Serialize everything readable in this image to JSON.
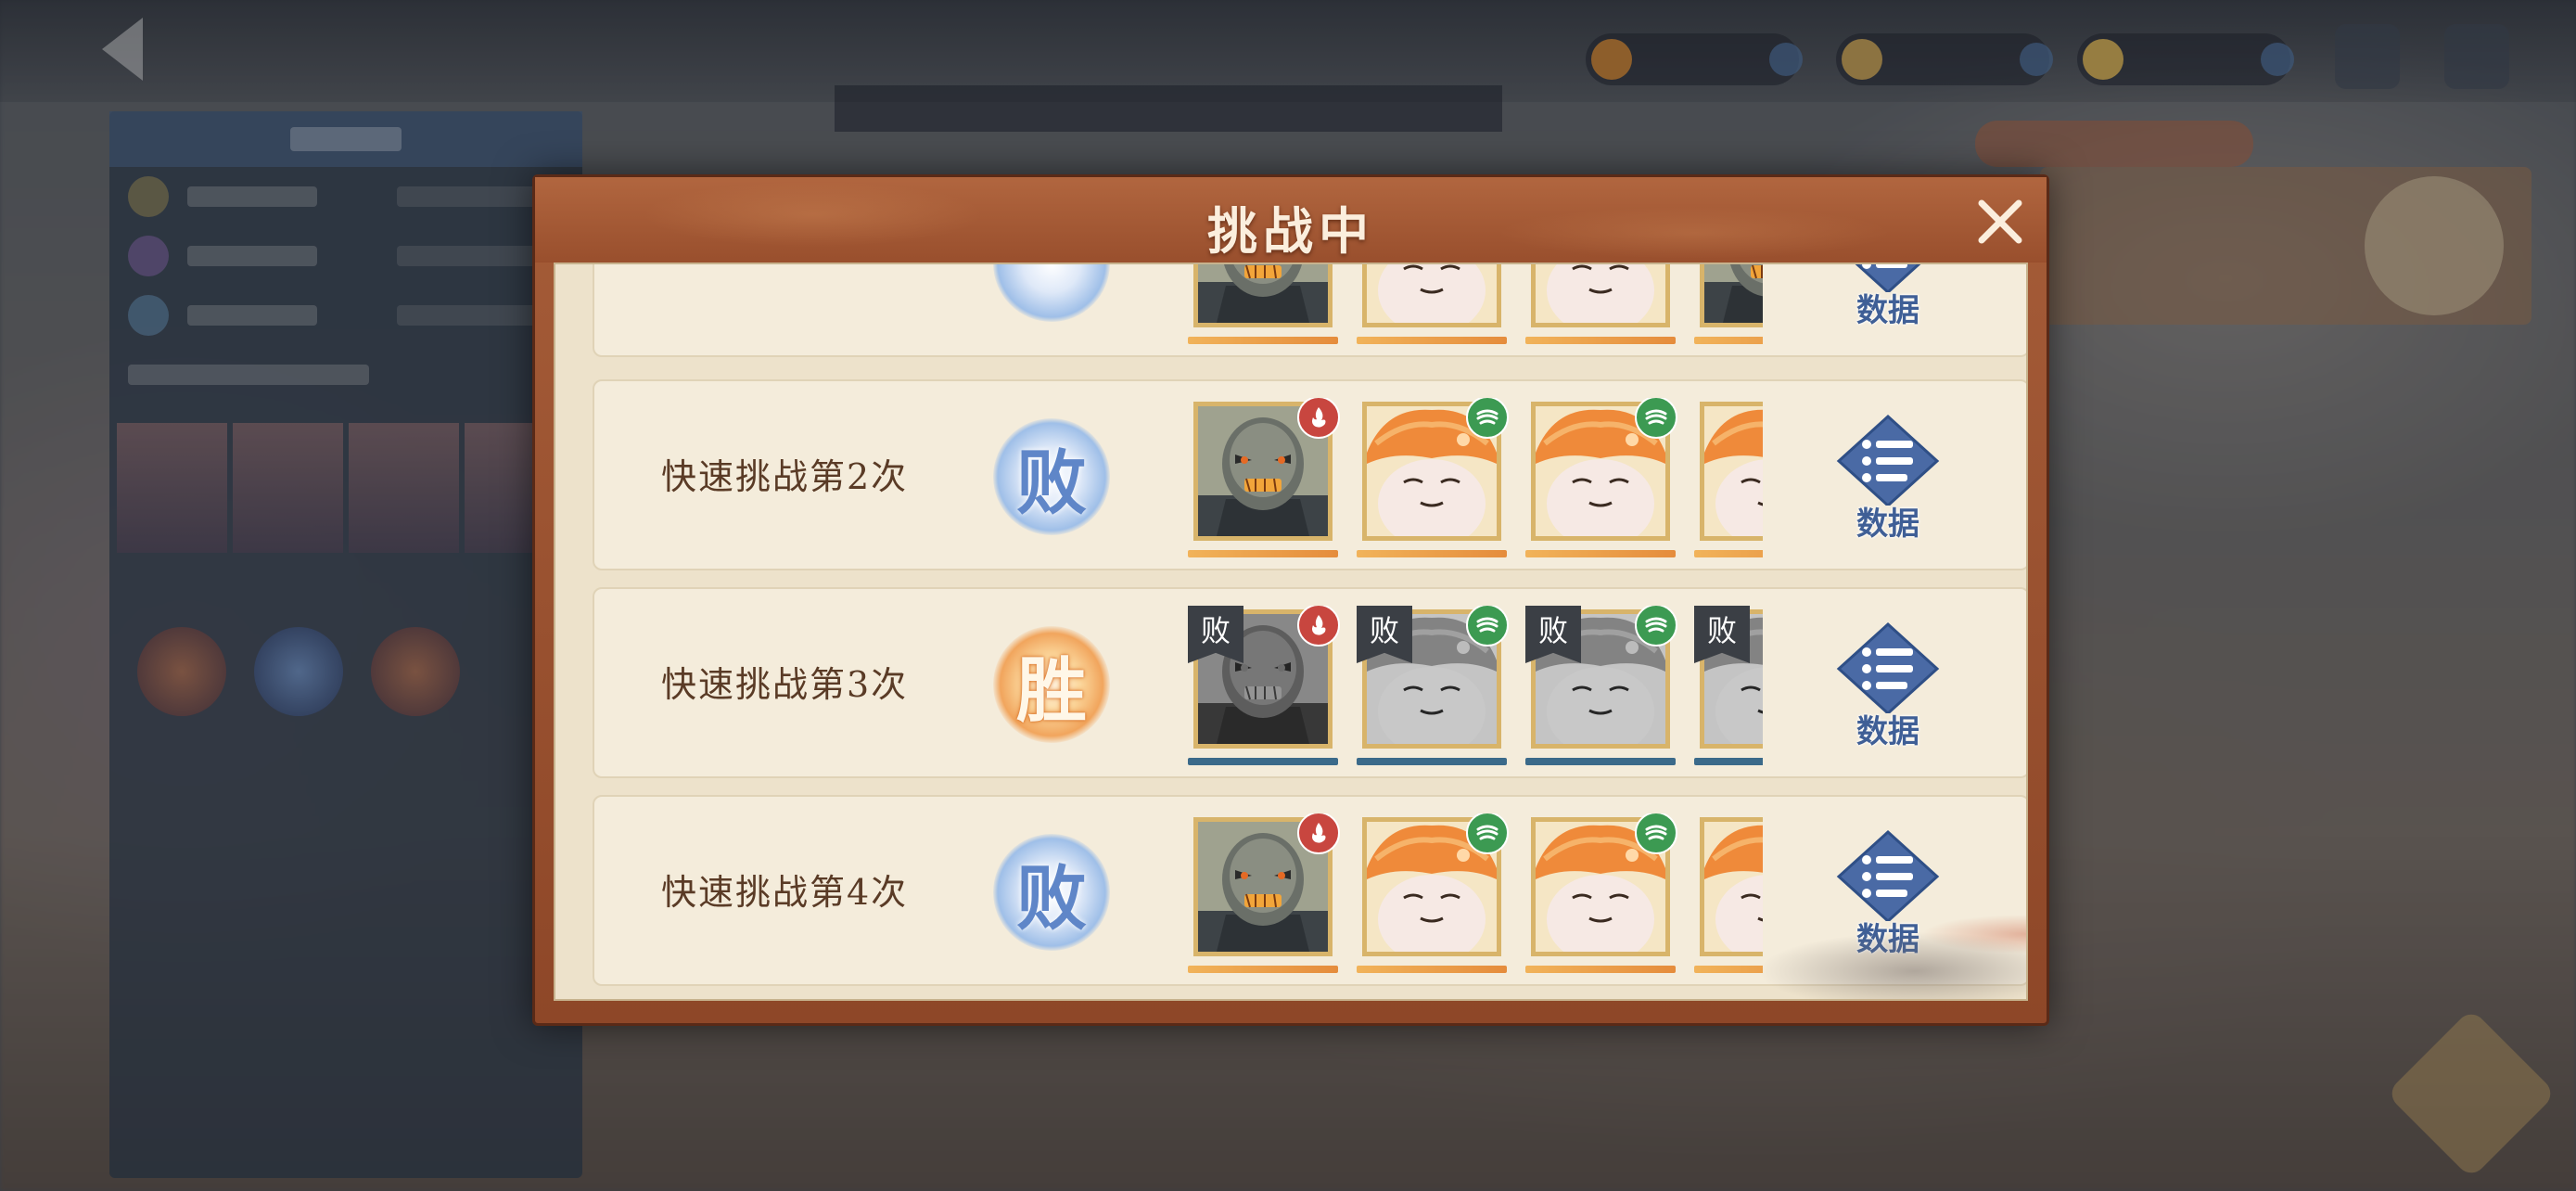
{
  "background": {
    "back_title": "返回",
    "resources": [
      {
        "icon": "coin-icon",
        "color": "#c9802e"
      },
      {
        "icon": "jade-icon",
        "color": "#c8a050"
      },
      {
        "icon": "gold-icon",
        "color": "#d8b050"
      }
    ]
  },
  "modal": {
    "title": "挑战中",
    "close_icon": "close-icon"
  },
  "rows": [
    {
      "label": "",
      "result": "lose",
      "result_text": "",
      "data_label": "数据",
      "partial": true,
      "units": [
        {
          "type": "golem",
          "status": "alive",
          "element": "fire"
        },
        {
          "type": "mushroom",
          "status": "alive",
          "element": "wind"
        },
        {
          "type": "mushroom",
          "status": "alive",
          "element": "wind"
        },
        {
          "type": "golem",
          "status": "alive",
          "element": "wind"
        }
      ]
    },
    {
      "label": "快速挑战第2次",
      "result": "lose",
      "result_text": "败",
      "data_label": "数据",
      "units": [
        {
          "type": "golem",
          "status": "alive",
          "element": "fire"
        },
        {
          "type": "mushroom",
          "status": "alive",
          "element": "wind"
        },
        {
          "type": "mushroom",
          "status": "alive",
          "element": "wind"
        },
        {
          "type": "mushroom",
          "status": "alive",
          "element": "wind"
        }
      ]
    },
    {
      "label": "快速挑战第3次",
      "result": "win",
      "result_text": "胜",
      "data_label": "数据",
      "units": [
        {
          "type": "golem",
          "status": "defeated",
          "element": "fire",
          "tag": "败"
        },
        {
          "type": "mushroom",
          "status": "defeated",
          "element": "wind",
          "tag": "败"
        },
        {
          "type": "mushroom",
          "status": "defeated",
          "element": "wind",
          "tag": "败"
        },
        {
          "type": "mushroom",
          "status": "defeated",
          "element": "wind",
          "tag": "败"
        }
      ]
    },
    {
      "label": "快速挑战第4次",
      "result": "lose",
      "result_text": "败",
      "data_label": "数据",
      "units": [
        {
          "type": "golem",
          "status": "alive",
          "element": "fire"
        },
        {
          "type": "mushroom",
          "status": "alive",
          "element": "wind"
        },
        {
          "type": "mushroom",
          "status": "alive",
          "element": "wind"
        },
        {
          "type": "mushroom",
          "status": "alive",
          "element": "wind"
        }
      ]
    }
  ],
  "colors": {
    "modal_frame": "#a55c38",
    "panel": "#ede2cb",
    "row_bg": "#f4ecdb",
    "label_text": "#5a3b26",
    "lose_accent": "#5f86c8",
    "win_accent": "#f1a55d",
    "data_icon": "#3f5f96"
  }
}
